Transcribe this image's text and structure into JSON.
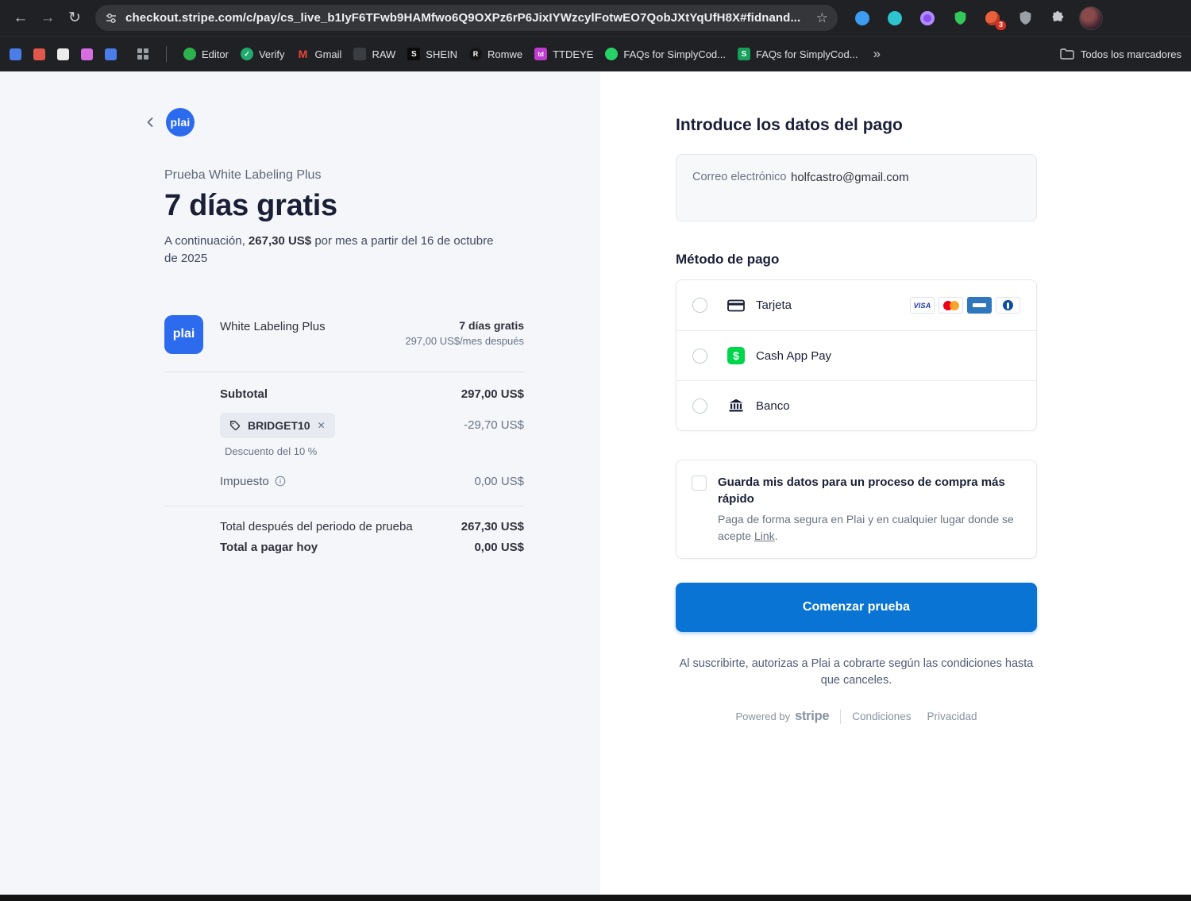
{
  "colors": {
    "accent_blue": "#0a74d4",
    "brand_blue": "#2c6bee",
    "left_panel_bg": "#f4f6f9",
    "browser_chrome": "#202124",
    "extension_badge_red": "#d93025"
  },
  "browser": {
    "back_icon": "←",
    "forward_icon": "→",
    "reload_icon": "↻",
    "star_icon": "☆",
    "url": "checkout.stripe.com/c/pay/cs_live_b1IyF6TFwb9HAMfwo6Q9OXPz6rP6JixIYWzcylFotwEO7QobJXtYqUfH8X#fidnand...",
    "extension_badge": "3",
    "overflow_icon": "»",
    "bookmarks": [
      {
        "label": "Editor",
        "favicon_text": ""
      },
      {
        "label": "Verify",
        "favicon_text": ""
      },
      {
        "label": "Gmail",
        "favicon_text": "M"
      },
      {
        "label": "RAW",
        "favicon_text": ""
      },
      {
        "label": "SHEIN",
        "favicon_text": "S"
      },
      {
        "label": "Romwe",
        "favicon_text": "R"
      },
      {
        "label": "TTDEYE",
        "favicon_text": "td"
      },
      {
        "label": "FAQs for SimplyCod...",
        "favicon_text": ""
      },
      {
        "label": "FAQs for SimplyCod...",
        "favicon_text": "S"
      },
      {
        "label": "Todos los marcadores",
        "favicon_text": ""
      }
    ]
  },
  "checkout": {
    "brand": "plai",
    "left": {
      "product_line": "Prueba White Labeling Plus",
      "headline": "7 días gratis",
      "sub_prefix": "A continuación, ",
      "sub_amount": "267,30 US$",
      "sub_suffix": " por mes a partir del 16 de octubre de 2025",
      "item_name": "White Labeling Plus",
      "item_trial": "7 días gratis",
      "item_after": "297,00 US$/mes después",
      "subtotal_label": "Subtotal",
      "subtotal_value": "297,00 US$",
      "coupon_code": "BRIDGET10",
      "coupon_remove_icon": "✕",
      "coupon_amount": "-29,70 US$",
      "coupon_desc": "Descuento del 10 %",
      "tax_label": "Impuesto",
      "tax_value": "0,00 US$",
      "total_after_label": "Total después del periodo de prueba",
      "total_after_value": "267,30 US$",
      "total_today_label": "Total a pagar hoy",
      "total_today_value": "0,00 US$"
    },
    "right": {
      "title": "Introduce los datos del pago",
      "email_label": "Correo electrónico",
      "email_value": "holfcastro@gmail.com",
      "payment_method_title": "Método de pago",
      "methods": [
        {
          "label": "Tarjeta"
        },
        {
          "label": "Cash App Pay"
        },
        {
          "label": "Banco"
        }
      ],
      "card_brands": [
        {
          "label": "VISA"
        }
      ],
      "cash_app_symbol": "$",
      "save_title": "Guarda mis datos para un proceso de compra más rápido",
      "save_desc_1": "Paga de forma segura en Plai y en cualquier lugar donde se acepte ",
      "save_link": "Link",
      "save_desc_2": ".",
      "submit_label": "Comenzar prueba",
      "terms": "Al suscribirte, autorizas a Plai a cobrarte según las condiciones hasta que canceles.",
      "powered_by": "Powered by",
      "stripe_wordmark": "stripe",
      "links": [
        "Condiciones",
        "Privacidad"
      ]
    }
  }
}
